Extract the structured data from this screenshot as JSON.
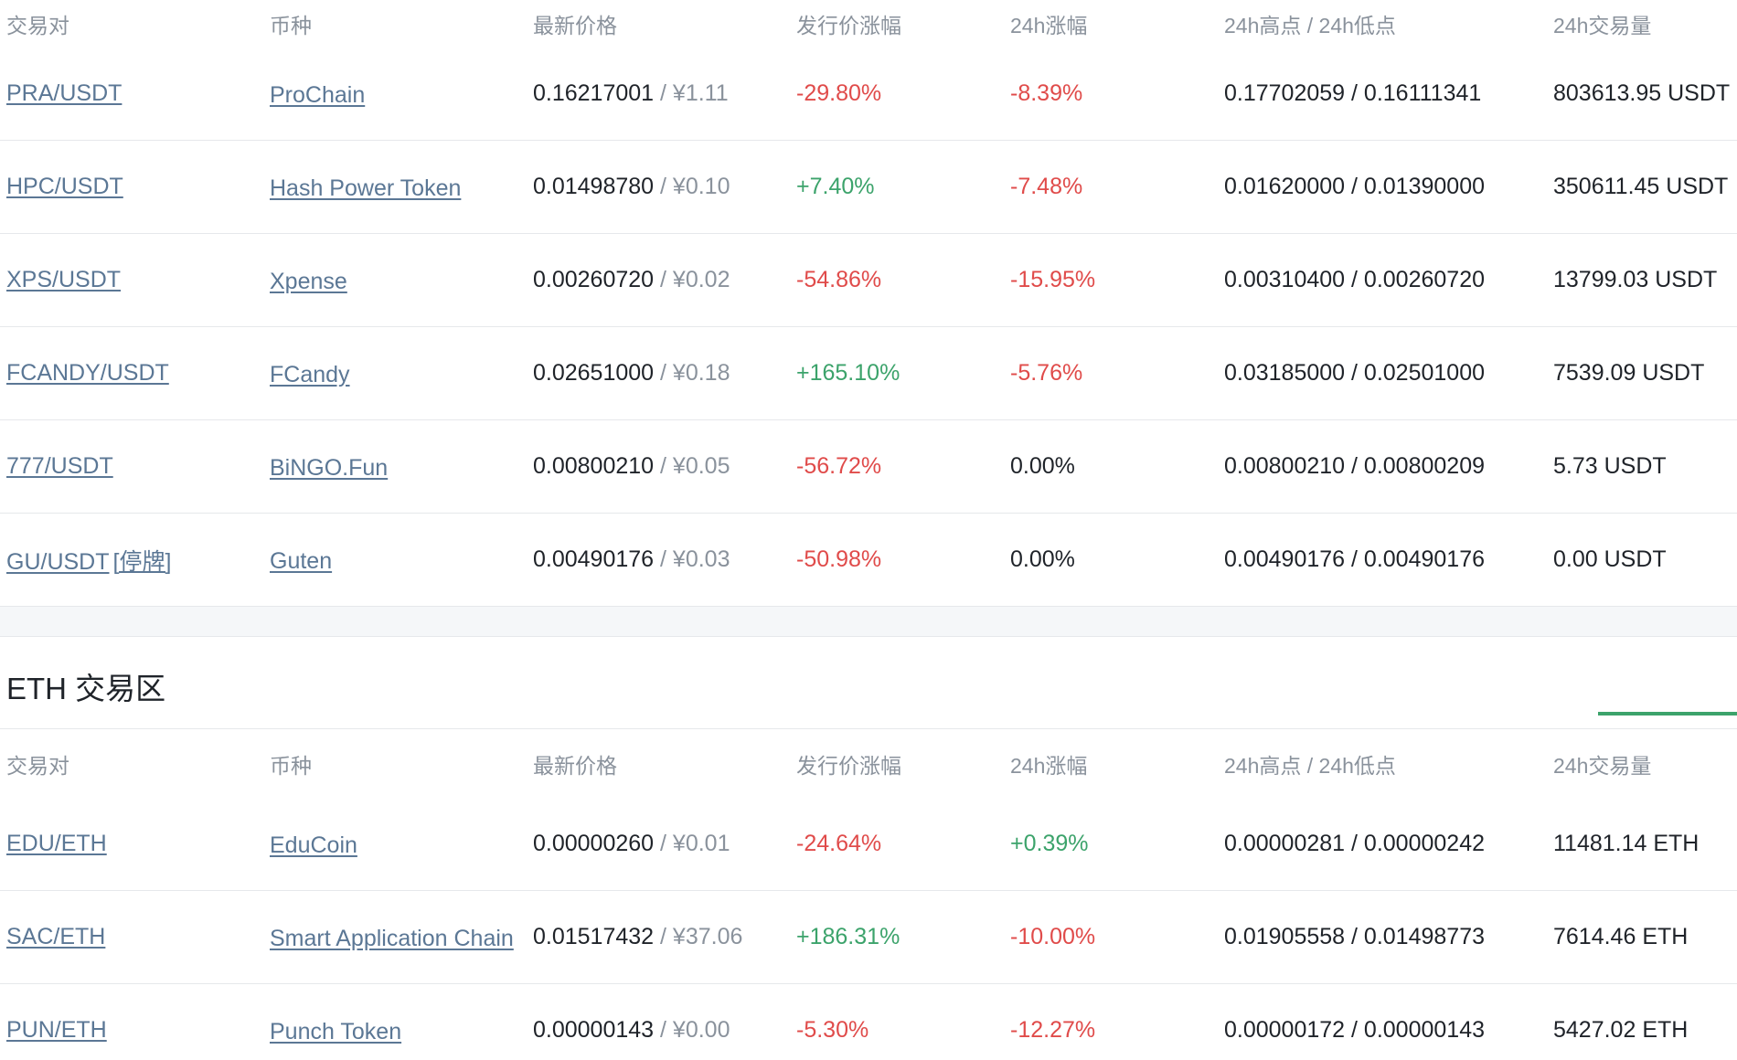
{
  "columns": [
    "交易对",
    "币种",
    "最新价格",
    "发行价涨幅",
    "24h涨幅",
    "24h高点 / 24h低点",
    "24h交易量"
  ],
  "usdt_rows": [
    {
      "pair": "PRA/USDT",
      "suspend": "",
      "coin": "ProChain",
      "price": "0.16217001",
      "price_cny": " / ¥1.11",
      "issue_change": "-29.80%",
      "issue_dir": "neg",
      "change_24h": "-8.39%",
      "change_dir": "neg",
      "high_low": "0.17702059 / 0.16111341",
      "volume": "803613.95 USDT"
    },
    {
      "pair": "HPC/USDT",
      "suspend": "",
      "coin": "Hash Power Token",
      "price": "0.01498780",
      "price_cny": " / ¥0.10",
      "issue_change": "+7.40%",
      "issue_dir": "pos",
      "change_24h": "-7.48%",
      "change_dir": "neg",
      "high_low": "0.01620000 / 0.01390000",
      "volume": "350611.45 USDT"
    },
    {
      "pair": "XPS/USDT",
      "suspend": "",
      "coin": "Xpense",
      "price": "0.00260720",
      "price_cny": " / ¥0.02",
      "issue_change": "-54.86%",
      "issue_dir": "neg",
      "change_24h": "-15.95%",
      "change_dir": "neg",
      "high_low": "0.00310400 / 0.00260720",
      "volume": "13799.03 USDT"
    },
    {
      "pair": "FCANDY/USDT",
      "suspend": "",
      "coin": "FCandy",
      "price": "0.02651000",
      "price_cny": " / ¥0.18",
      "issue_change": "+165.10%",
      "issue_dir": "pos",
      "change_24h": "-5.76%",
      "change_dir": "neg",
      "high_low": "0.03185000 / 0.02501000",
      "volume": "7539.09 USDT"
    },
    {
      "pair": "777/USDT",
      "suspend": "",
      "coin": "BiNGO.Fun",
      "price": "0.00800210",
      "price_cny": " / ¥0.05",
      "issue_change": "-56.72%",
      "issue_dir": "neg",
      "change_24h": "0.00%",
      "change_dir": "neutral",
      "high_low": "0.00800210 / 0.00800209",
      "volume": "5.73 USDT"
    },
    {
      "pair": "GU/USDT",
      "suspend": "[停牌]",
      "coin": "Guten",
      "price": "0.00490176",
      "price_cny": " / ¥0.03",
      "issue_change": "-50.98%",
      "issue_dir": "neg",
      "change_24h": "0.00%",
      "change_dir": "neutral",
      "high_low": "0.00490176 / 0.00490176",
      "volume": "0.00 USDT"
    }
  ],
  "eth_section": {
    "title": "ETH 交易区"
  },
  "eth_rows": [
    {
      "pair": "EDU/ETH",
      "suspend": "",
      "coin": "EduCoin",
      "price": "0.00000260",
      "price_cny": " / ¥0.01",
      "issue_change": "-24.64%",
      "issue_dir": "neg",
      "change_24h": "+0.39%",
      "change_dir": "pos",
      "high_low": "0.00000281 / 0.00000242",
      "volume": "11481.14 ETH"
    },
    {
      "pair": "SAC/ETH",
      "suspend": "",
      "coin": "Smart Application Chain",
      "price": "0.01517432",
      "price_cny": " / ¥37.06",
      "issue_change": "+186.31%",
      "issue_dir": "pos",
      "change_24h": "-10.00%",
      "change_dir": "neg",
      "high_low": "0.01905558 / 0.01498773",
      "volume": "7614.46 ETH"
    },
    {
      "pair": "PUN/ETH",
      "suspend": "",
      "coin": "Punch Token",
      "price": "0.00000143",
      "price_cny": " / ¥0.00",
      "issue_change": "-5.30%",
      "issue_dir": "neg",
      "change_24h": "-12.27%",
      "change_dir": "neg",
      "high_low": "0.00000172 / 0.00000143",
      "volume": "5427.02 ETH"
    }
  ],
  "colors": {
    "negative": "#e04b4a",
    "positive": "#3ca36b",
    "link": "#5b7795",
    "accent": "#3ca36b"
  }
}
